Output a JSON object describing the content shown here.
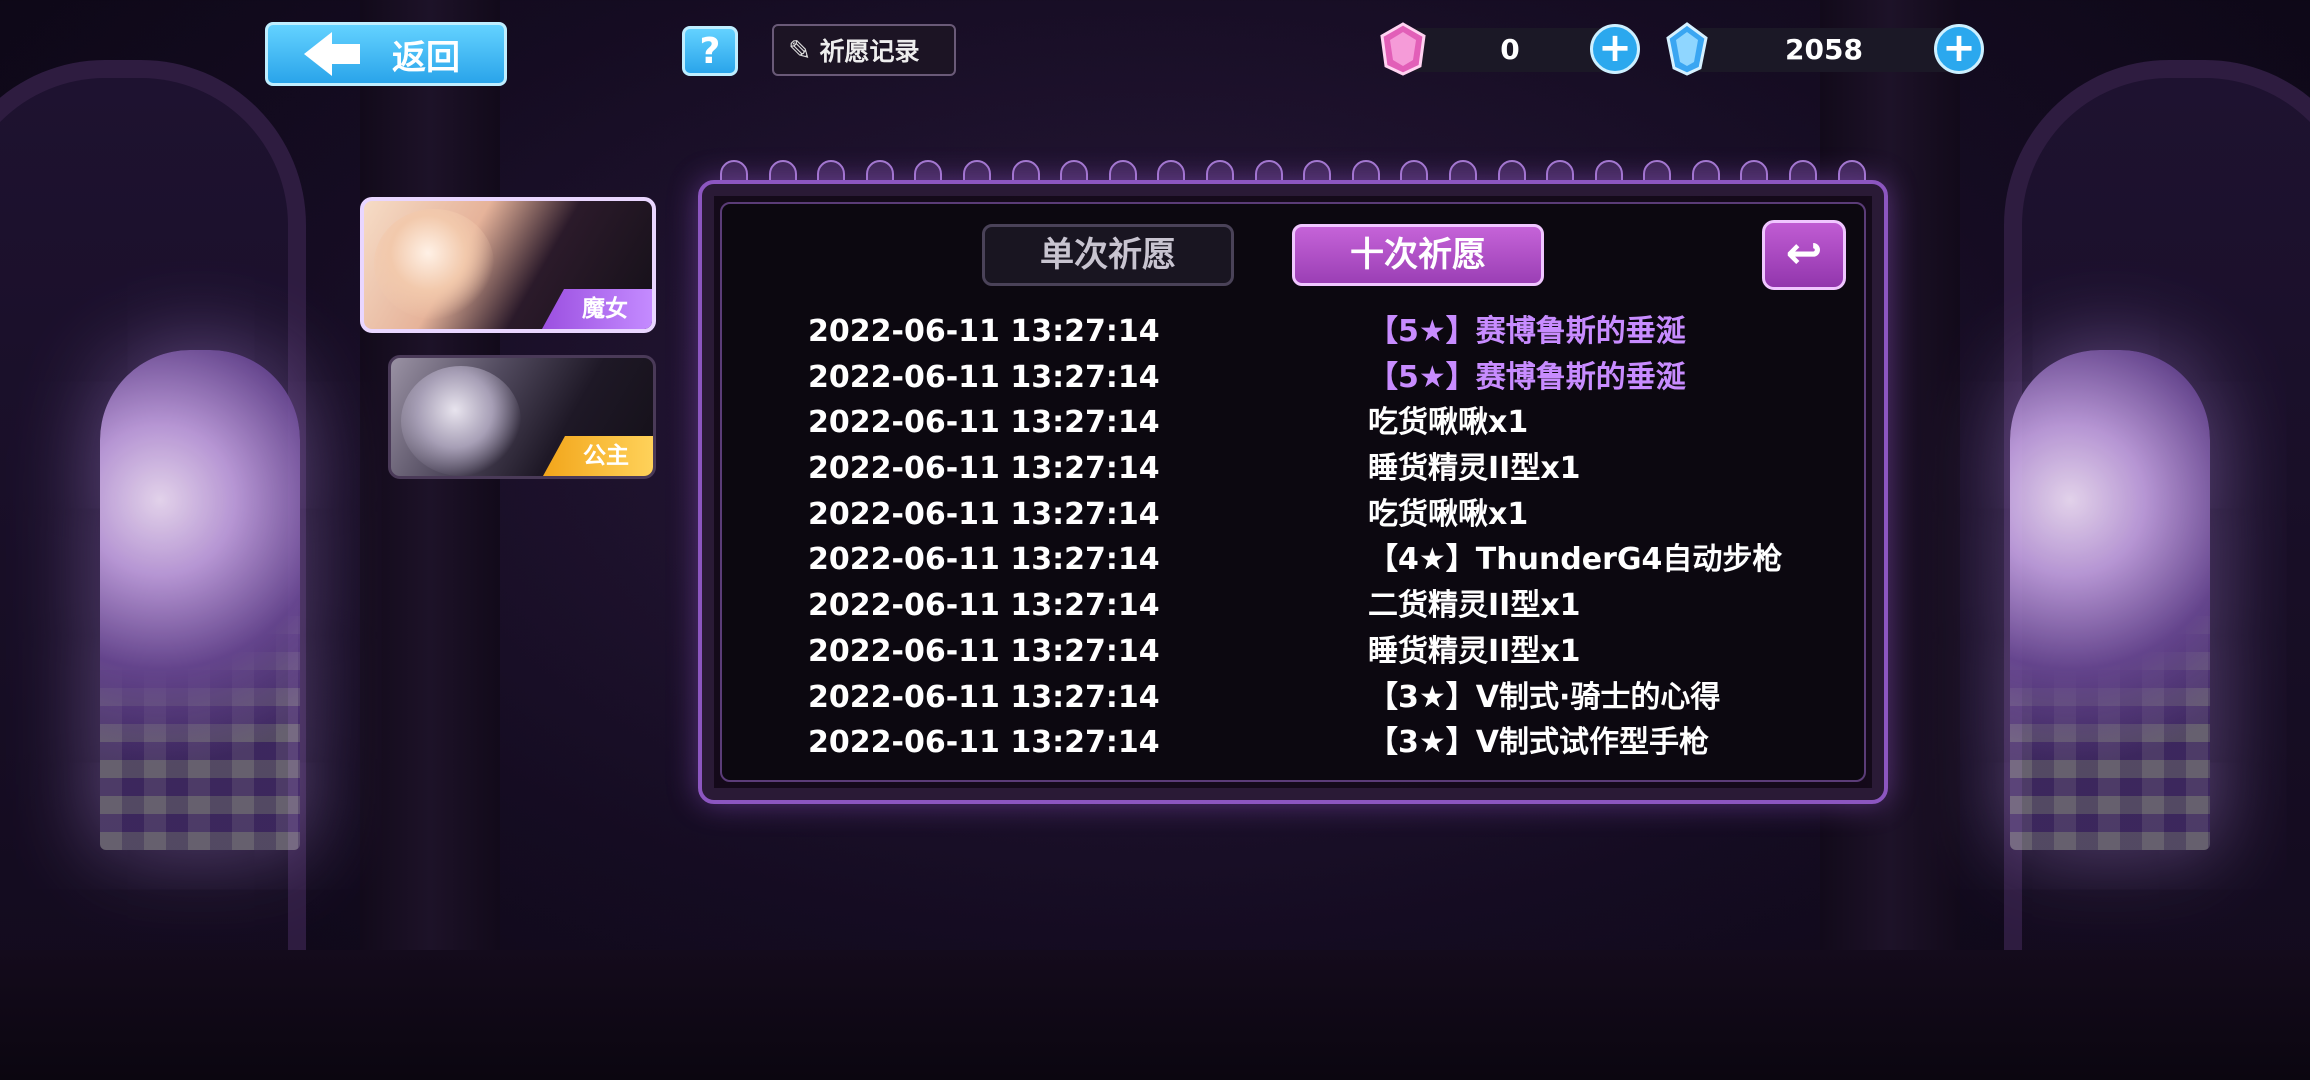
{
  "header": {
    "back_label": "返回",
    "help_label": "?",
    "record_label": "祈愿记录"
  },
  "currencies": [
    {
      "icon": "pink-gem-icon",
      "value": "0",
      "plus": "+"
    },
    {
      "icon": "blue-crystal-icon",
      "value": "2058",
      "plus": "+"
    }
  ],
  "characters": [
    {
      "tag": "魔女",
      "selected": true
    },
    {
      "tag": "公主",
      "selected": false
    }
  ],
  "tabs": {
    "single": "单次祈愿",
    "ten": "十次祈愿",
    "active": "ten"
  },
  "records": [
    {
      "time": "2022-06-11 13:27:14",
      "item": "【5★】赛博鲁斯的垂涎",
      "rare": true
    },
    {
      "time": "2022-06-11 13:27:14",
      "item": "【5★】赛博鲁斯的垂涎",
      "rare": true
    },
    {
      "time": "2022-06-11 13:27:14",
      "item": "吃货啾啾x1",
      "rare": false
    },
    {
      "time": "2022-06-11 13:27:14",
      "item": "睡货精灵II型x1",
      "rare": false
    },
    {
      "time": "2022-06-11 13:27:14",
      "item": "吃货啾啾x1",
      "rare": false
    },
    {
      "time": "2022-06-11 13:27:14",
      "item": "【4★】ThunderG4自动步枪",
      "rare": false
    },
    {
      "time": "2022-06-11 13:27:14",
      "item": "二货精灵II型x1",
      "rare": false
    },
    {
      "time": "2022-06-11 13:27:14",
      "item": "睡货精灵II型x1",
      "rare": false
    },
    {
      "time": "2022-06-11 13:27:14",
      "item": "【3★】V制式·骑士的心得",
      "rare": false
    },
    {
      "time": "2022-06-11 13:27:14",
      "item": "【3★】V制式试作型手枪",
      "rare": false
    }
  ],
  "colors": {
    "accent": "#2aa4ea",
    "tab_active": "#b04ec8",
    "rare_text": "#c88cff"
  }
}
